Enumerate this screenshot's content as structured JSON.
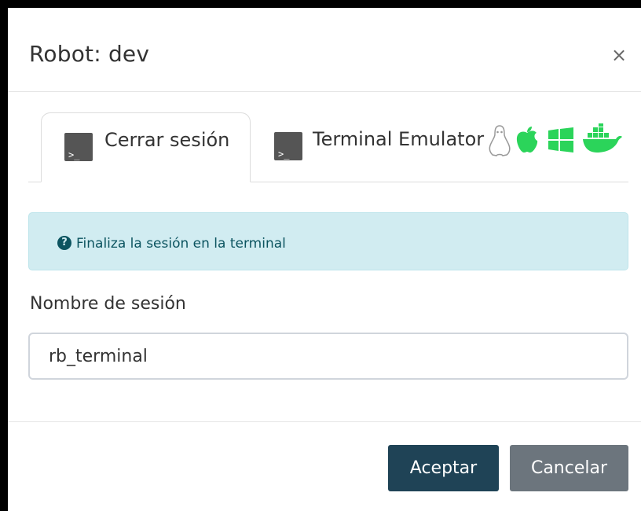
{
  "modal": {
    "title": "Robot: dev",
    "close_glyph": "×"
  },
  "tabs": [
    {
      "label": "Cerrar sesión",
      "icon": "terminal-icon",
      "active": true
    },
    {
      "label": "Terminal Emulator",
      "icon": "terminal-icon",
      "active": false
    }
  ],
  "os_icons": [
    "linux-icon",
    "apple-icon",
    "windows-icon",
    "docker-icon"
  ],
  "alert": {
    "icon": "question-circle-icon",
    "text": "Finaliza la sesión en la terminal"
  },
  "session_field": {
    "label": "Nombre de sesión",
    "value": "rb_terminal"
  },
  "buttons": {
    "accept": "Aceptar",
    "cancel": "Cancelar"
  },
  "colors": {
    "accent": "#1f4356",
    "secondary": "#6c757d",
    "os_icon_green": "#2bd45a",
    "alert_bg": "#d1ecf1"
  }
}
